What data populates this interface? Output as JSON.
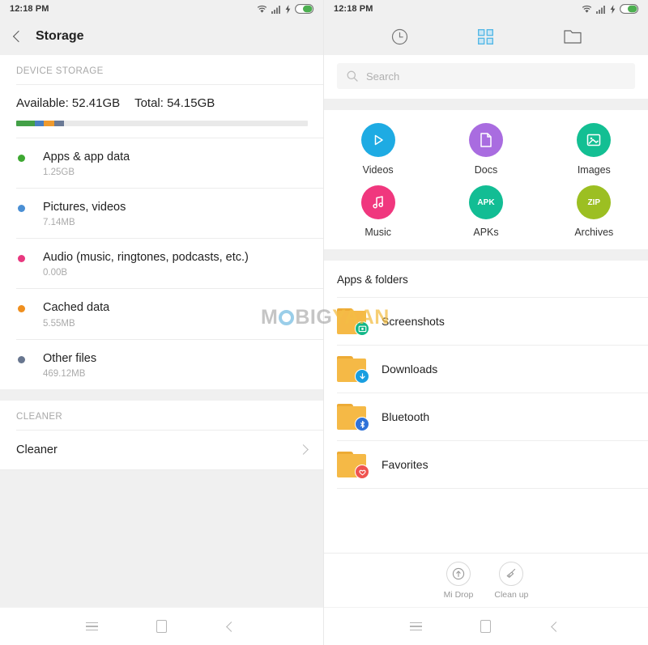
{
  "watermark": {
    "part1": "M",
    "part2": "BIG",
    "part3": "YAAN"
  },
  "left": {
    "statusbar": {
      "time": "12:18 PM",
      "wifi_icon": "wifi-icon",
      "signal_icon": "signal-icon",
      "charging_icon": "charging-bolt-icon",
      "battery_icon": "battery-icon"
    },
    "titlebar": {
      "back_icon": "back-chevron-icon",
      "title": "Storage"
    },
    "section_device": "DEVICE STORAGE",
    "storage": {
      "available_label": "Available: 52.41GB",
      "total_label": "Total: 54.15GB",
      "segments": [
        {
          "color": "#43a047",
          "pct": 6.5
        },
        {
          "color": "#4a7fc1",
          "pct": 3.0
        },
        {
          "color": "#ef9a2e",
          "pct": 3.5
        },
        {
          "color": "#6b7a96",
          "pct": 3.5
        }
      ]
    },
    "categories": [
      {
        "name": "Apps & app data",
        "size": "1.25GB",
        "color": "#3ea832"
      },
      {
        "name": "Pictures, videos",
        "size": "7.14MB",
        "color": "#4a8fd4"
      },
      {
        "name": "Audio (music, ringtones, podcasts, etc.)",
        "size": "0.00B",
        "color": "#e8387f"
      },
      {
        "name": "Cached data",
        "size": "5.55MB",
        "color": "#ef8f1f"
      },
      {
        "name": "Other files",
        "size": "469.12MB",
        "color": "#68768f"
      }
    ],
    "section_cleaner": "CLEANER",
    "cleaner": {
      "label": "Cleaner",
      "chevron_icon": "chevron-right-icon"
    },
    "navbar": {
      "menu_icon": "menu-icon",
      "home_icon": "home-icon",
      "back_icon": "back-icon"
    }
  },
  "right": {
    "statusbar": {
      "time": "12:18 PM",
      "wifi_icon": "wifi-icon",
      "signal_icon": "signal-icon",
      "charging_icon": "charging-bolt-icon",
      "battery_icon": "battery-icon"
    },
    "tabs": [
      {
        "name": "recent-tab",
        "icon": "clock-icon",
        "active": false
      },
      {
        "name": "categories-tab",
        "icon": "grid-icon",
        "active": true
      },
      {
        "name": "folders-tab",
        "icon": "folder-icon",
        "active": false
      }
    ],
    "active_tab_color": "#56b8e6",
    "search": {
      "placeholder": "Search",
      "value": "",
      "icon": "search-icon"
    },
    "categories": [
      {
        "label": "Videos",
        "icon": "play-icon",
        "color": "#1eabe3"
      },
      {
        "label": "Docs",
        "icon": "document-icon",
        "color": "#a96ce0"
      },
      {
        "label": "Images",
        "icon": "image-icon",
        "color": "#13bf93"
      },
      {
        "label": "Music",
        "icon": "music-icon",
        "color": "#f0377e"
      },
      {
        "label": "APKs",
        "icon": "apk-icon",
        "color": "#12bd94",
        "text": "APK"
      },
      {
        "label": "Archives",
        "icon": "zip-icon",
        "color": "#9cbf22",
        "text": "ZIP"
      }
    ],
    "folders_heading": "Apps & folders",
    "folders": [
      {
        "name": "Screenshots",
        "badge_icon": "screenshot-badge-icon",
        "badge_color": "#12b788"
      },
      {
        "name": "Downloads",
        "badge_icon": "download-badge-icon",
        "badge_color": "#199ee0"
      },
      {
        "name": "Bluetooth",
        "badge_icon": "bluetooth-badge-icon",
        "badge_color": "#2f72d8"
      },
      {
        "name": "Favorites",
        "badge_icon": "heart-badge-icon",
        "badge_color": "#ef5350"
      }
    ],
    "tools": [
      {
        "label": "Mi Drop",
        "icon": "mi-drop-icon"
      },
      {
        "label": "Clean up",
        "icon": "broom-icon"
      }
    ],
    "navbar": {
      "menu_icon": "menu-icon",
      "home_icon": "home-icon",
      "back_icon": "back-icon"
    }
  }
}
